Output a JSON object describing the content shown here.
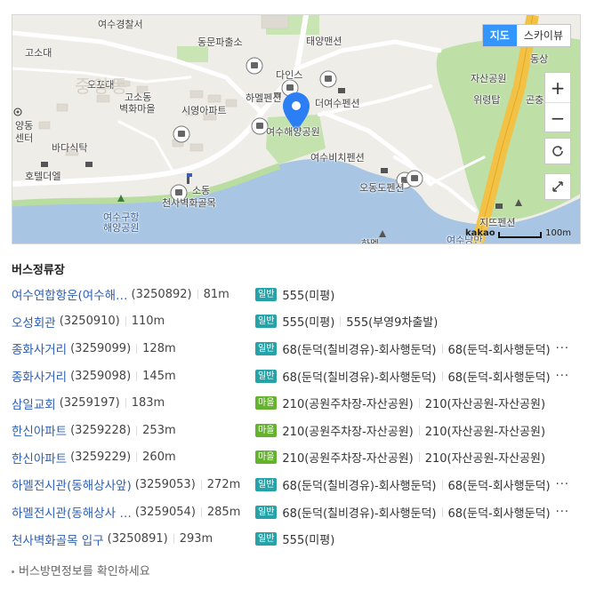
{
  "map": {
    "type_toggle": {
      "map_label": "지도",
      "skyview_label": "스카이뷰"
    },
    "zoom_in": "+",
    "zoom_out": "−",
    "scale_label": "100m",
    "provider": "kakao",
    "place_labels": [
      "여수경찰서",
      "동문파출소",
      "태양맨션",
      "고소대",
      "오포대",
      "중앙동",
      "고소동",
      "벽화마을",
      "시영아파트",
      "양동",
      "센터",
      "바다식탁",
      "다인스",
      "하멜펜션",
      "더여수펜션",
      "여수해양공원",
      "여수비치펜션",
      "오동도펜션",
      "호텔더엘",
      "소동",
      "천사벽화골목",
      "여수구항",
      "해양공원",
      "자산공원",
      "위령탑",
      "곤충",
      "동상",
      "지뜨펜션",
      "하멜",
      "여수낭만"
    ]
  },
  "section_title": "버스정류장",
  "stops": [
    {
      "name": "여수연합항운(여수해…",
      "id": "(3250892)",
      "dist": "81m",
      "badge": "일반",
      "badge_type": "general",
      "routes": [
        "555(미평)"
      ],
      "more": false
    },
    {
      "name": "오성회관",
      "id": "(3250910)",
      "dist": "110m",
      "badge": "일반",
      "badge_type": "general",
      "routes": [
        "555(미평)",
        "555(부영9차출발)"
      ],
      "more": false
    },
    {
      "name": "종화사거리",
      "id": "(3259099)",
      "dist": "128m",
      "badge": "일반",
      "badge_type": "general",
      "routes": [
        "68(둔덕(칠비경유)-회사행둔덕)",
        "68(둔덕-회사행둔덕)"
      ],
      "more": true
    },
    {
      "name": "종화사거리",
      "id": "(3259098)",
      "dist": "145m",
      "badge": "일반",
      "badge_type": "general",
      "routes": [
        "68(둔덕(칠비경유)-회사행둔덕)",
        "68(둔덕-회사행둔덕)"
      ],
      "more": true
    },
    {
      "name": "삼일교회",
      "id": "(3259197)",
      "dist": "183m",
      "badge": "마을",
      "badge_type": "village",
      "routes": [
        "210(공원주차장-자산공원)",
        "210(자산공원-자산공원)"
      ],
      "more": false
    },
    {
      "name": "한신아파트",
      "id": "(3259228)",
      "dist": "253m",
      "badge": "마을",
      "badge_type": "village",
      "routes": [
        "210(공원주차장-자산공원)",
        "210(자산공원-자산공원)"
      ],
      "more": false
    },
    {
      "name": "한신아파트",
      "id": "(3259229)",
      "dist": "260m",
      "badge": "마을",
      "badge_type": "village",
      "routes": [
        "210(공원주차장-자산공원)",
        "210(자산공원-자산공원)"
      ],
      "more": false
    },
    {
      "name": "하멜전시관(동해상사앞)",
      "id": "(3259053)",
      "dist": "272m",
      "badge": "일반",
      "badge_type": "general",
      "routes": [
        "68(둔덕(칠비경유)-회사행둔덕)",
        "68(둔덕-회사행둔덕)"
      ],
      "more": true
    },
    {
      "name": "하멜전시관(동해상사 …",
      "id": "(3259054)",
      "dist": "285m",
      "badge": "일반",
      "badge_type": "general",
      "routes": [
        "68(둔덕(칠비경유)-회사행둔덕)",
        "68(둔덕-회사행둔덕)"
      ],
      "more": true
    },
    {
      "name": "천사벽화골목 입구",
      "id": "(3250891)",
      "dist": "293m",
      "badge": "일반",
      "badge_type": "general",
      "routes": [
        "555(미평)"
      ],
      "more": false
    }
  ],
  "more_label": "···",
  "footnote": "버스방면정보를 확인하세요",
  "colors": {
    "link": "#2c5fb4",
    "badge_general": "#25a3a8",
    "badge_village": "#65b22f",
    "marker": "#2c7ef5"
  }
}
